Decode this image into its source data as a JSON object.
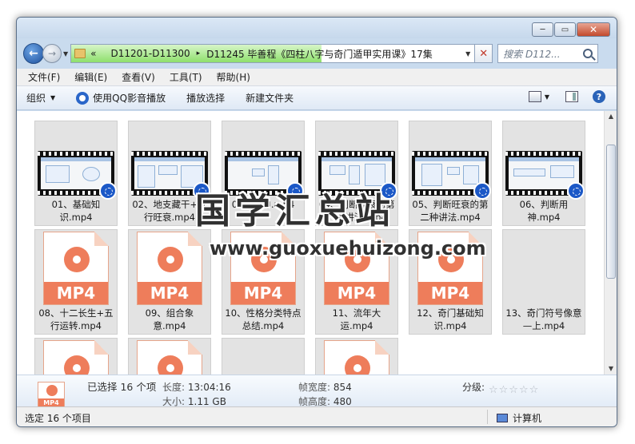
{
  "address": {
    "chevrons": "«",
    "crumb1": "D11201-D11300",
    "separator": "▸",
    "crumb2": "D11245 毕善程《四柱八字与奇门遁甲实用课》17集",
    "progress_percent": 62,
    "clear_label": "✕",
    "search_placeholder": "搜索 D112..."
  },
  "window": {
    "close_label": "✕",
    "max_label": "▭",
    "min_label": "─"
  },
  "menu": [
    "文件(F)",
    "编辑(E)",
    "查看(V)",
    "工具(T)",
    "帮助(H)"
  ],
  "toolbar": {
    "organize": "组织",
    "play_qq": "使用QQ影音播放",
    "play_selection": "播放选择",
    "new_folder": "新建文件夹",
    "help": "?"
  },
  "files": [
    {
      "name": "01、基础知识.mp4",
      "kind": "video"
    },
    {
      "name": "02、地支藏干+五行旺衰.mp4",
      "kind": "video"
    },
    {
      "name": "03、十神.mp4",
      "kind": "video"
    },
    {
      "name": "04、判断旺衰的第一种讲法.mp4",
      "kind": "video"
    },
    {
      "name": "05、判断旺衰的第二种讲法.mp4",
      "kind": "video"
    },
    {
      "name": "06、判断用神.mp4",
      "kind": "video"
    },
    {
      "name": "08、十二长生+五行运转.mp4",
      "kind": "mp4"
    },
    {
      "name": "09、组合象意.mp4",
      "kind": "mp4"
    },
    {
      "name": "10、性格分类特点总结.mp4",
      "kind": "mp4"
    },
    {
      "name": "11、流年大运.mp4",
      "kind": "mp4"
    },
    {
      "name": "12、奇门基础知识.mp4",
      "kind": "mp4"
    },
    {
      "name": "13、奇门符号像意—上.mp4",
      "kind": "blank"
    }
  ],
  "mp4_badge": "MP4",
  "details": {
    "icon_text": "MP4",
    "selected": "已选择 16 个项",
    "length_label": "长度:",
    "length_value": "13:04:16",
    "size_label": "大小:",
    "size_value": "1.11 GB",
    "width_label": "帧宽度:",
    "width_value": "854",
    "height_label": "帧高度:",
    "height_value": "480",
    "rating_label": "分级:",
    "stars": "☆☆☆☆☆"
  },
  "status": {
    "selected": "选定 16 个项目",
    "location": "计算机"
  },
  "watermark": {
    "title": "国学汇总站",
    "url": "www.guoxuehuizong.com"
  }
}
